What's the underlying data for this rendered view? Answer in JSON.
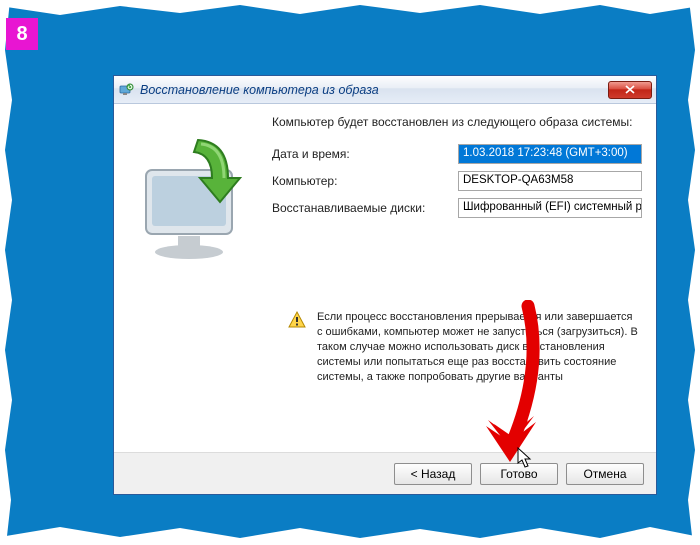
{
  "badge": "8",
  "dialog": {
    "title": "Восстановление компьютера из образа",
    "heading": "Компьютер будет восстановлен из следующего образа системы:",
    "fields": {
      "datetime_label": "Дата и время:",
      "datetime_value": "1.03.2018 17:23:48 (GMT+3:00)",
      "computer_label": "Компьютер:",
      "computer_value": "DESKTOP-QA63M58",
      "disks_label": "Восстанавливаемые диски:",
      "disks_value": "Шифрованный (EFI) системный раздел"
    },
    "warning": "Если процесс восстановления прерывается или завершается с ошибками, компьютер может не запуститься (загрузиться). В таком случае можно использовать диск восстановления системы или попытаться еще раз восстановить состояние системы, а также попробовать другие варианты",
    "buttons": {
      "back": "< Назад",
      "ready": "Готово",
      "cancel": "Отмена"
    }
  }
}
